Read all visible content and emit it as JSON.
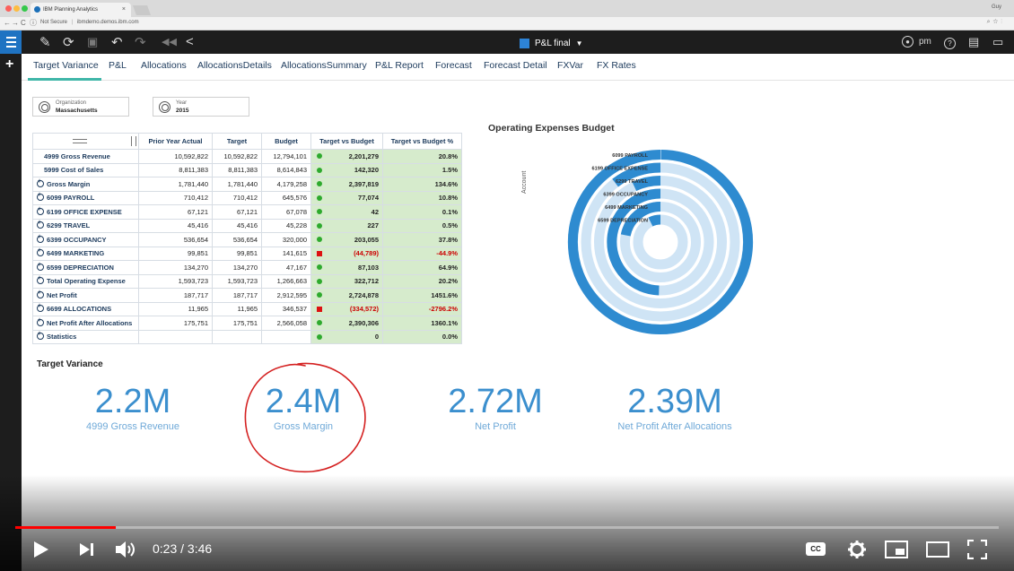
{
  "browser": {
    "tab_title": "IBM Planning Analytics",
    "tab_close": "×",
    "user_chip": "Guy",
    "security": "Not Secure",
    "url": "ibmdemo.demos.ibm.com"
  },
  "toolbar": {
    "workbook": "P&L final",
    "user": "pm"
  },
  "tabs": [
    "Target Variance",
    "P&L",
    "Allocations",
    "AllocationsDetails",
    "AllocationsSummary",
    "P&L Report",
    "Forecast",
    "Forecast Detail",
    "FXVar",
    "FX Rates"
  ],
  "context": {
    "organization_label": "Organization",
    "organization_value": "Massachusetts",
    "year_label": "Year",
    "year_value": "2015"
  },
  "grid": {
    "columns": [
      "Prior Year Actual",
      "Target",
      "Budget",
      "Target vs Budget",
      "Target vs Budget %"
    ],
    "rows": [
      {
        "label": "4999 Gross Revenue",
        "expand": false,
        "pya": "10,592,822",
        "target": "10,592,822",
        "budget": "12,794,101",
        "ind": "green",
        "tvb": "2,201,279",
        "pct": "20.8%"
      },
      {
        "label": "5999 Cost of Sales",
        "expand": false,
        "pya": "8,811,383",
        "target": "8,811,383",
        "budget": "8,614,843",
        "ind": "green",
        "tvb": "142,320",
        "pct": "1.5%"
      },
      {
        "label": "Gross Margin",
        "expand": true,
        "pya": "1,781,440",
        "target": "1,781,440",
        "budget": "4,179,258",
        "ind": "green",
        "tvb": "2,397,819",
        "pct": "134.6%"
      },
      {
        "label": "6099 PAYROLL",
        "expand": true,
        "pya": "710,412",
        "target": "710,412",
        "budget": "645,576",
        "ind": "green",
        "tvb": "77,074",
        "pct": "10.8%"
      },
      {
        "label": "6199 OFFICE EXPENSE",
        "expand": true,
        "pya": "67,121",
        "target": "67,121",
        "budget": "67,078",
        "ind": "green",
        "tvb": "42",
        "pct": "0.1%"
      },
      {
        "label": "6299 TRAVEL",
        "expand": true,
        "pya": "45,416",
        "target": "45,416",
        "budget": "45,228",
        "ind": "green",
        "tvb": "227",
        "pct": "0.5%"
      },
      {
        "label": "6399 OCCUPANCY",
        "expand": true,
        "pya": "536,654",
        "target": "536,654",
        "budget": "320,000",
        "ind": "green",
        "tvb": "203,055",
        "pct": "37.8%"
      },
      {
        "label": "6499 MARKETING",
        "expand": true,
        "pya": "99,851",
        "target": "99,851",
        "budget": "141,615",
        "ind": "red",
        "tvb": "(44,789)",
        "pct": "-44.9%"
      },
      {
        "label": "6599 DEPRECIATION",
        "expand": true,
        "pya": "134,270",
        "target": "134,270",
        "budget": "47,167",
        "ind": "green",
        "tvb": "87,103",
        "pct": "64.9%"
      },
      {
        "label": "Total Operating Expense",
        "expand": true,
        "pya": "1,593,723",
        "target": "1,593,723",
        "budget": "1,266,663",
        "ind": "green",
        "tvb": "322,712",
        "pct": "20.2%"
      },
      {
        "label": "Net Profit",
        "expand": true,
        "pya": "187,717",
        "target": "187,717",
        "budget": "2,912,595",
        "ind": "green",
        "tvb": "2,724,878",
        "pct": "1451.6%"
      },
      {
        "label": "6699 ALLOCATIONS",
        "expand": true,
        "pya": "11,965",
        "target": "11,965",
        "budget": "346,537",
        "ind": "red",
        "tvb": "(334,572)",
        "pct": "-2796.2%"
      },
      {
        "label": "Net Profit After Allocations",
        "expand": true,
        "pya": "175,751",
        "target": "175,751",
        "budget": "2,566,058",
        "ind": "green",
        "tvb": "2,390,306",
        "pct": "1360.1%"
      },
      {
        "label": "Statistics",
        "expand": true,
        "pya": "",
        "target": "",
        "budget": "",
        "ind": "green",
        "tvb": "0",
        "pct": "0.0%"
      }
    ]
  },
  "chart_data": {
    "type": "radial_bar",
    "title": "Operating Expenses Budget",
    "ylabel": "Account",
    "categories": [
      "6099 PAYROLL",
      "6199 OFFICE EXPENSE",
      "6299 TRAVEL",
      "6399 OCCUPANCY",
      "6499 MARKETING",
      "6599 DEPRECIATION"
    ],
    "values": [
      645576,
      67078,
      45228,
      320000,
      141615,
      47167
    ],
    "colors": {
      "bar": "#2e8bd0",
      "track": "#cfe4f5"
    }
  },
  "kpis": {
    "title": "Target Variance",
    "items": [
      {
        "value": "2.2M",
        "label": "4999 Gross Revenue"
      },
      {
        "value": "2.4M",
        "label": "Gross Margin"
      },
      {
        "value": "2.72M",
        "label": "Net Profit"
      },
      {
        "value": "2.39M",
        "label": "Net Profit After Allocations"
      }
    ]
  },
  "video": {
    "time": "0:23 / 3:46",
    "progress": 0.102,
    "cc": "CC"
  },
  "colors": {
    "accent": "#1f73c2",
    "kpi": "#3b8fce",
    "grid_green": "#d6ebcc",
    "annotation": "#d42020",
    "progress": "#ff0000"
  }
}
